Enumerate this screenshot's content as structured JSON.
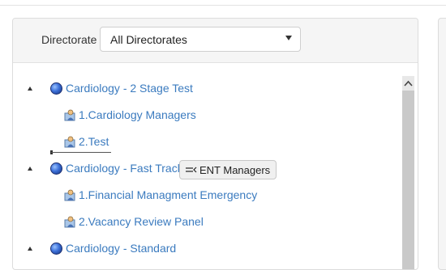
{
  "filter": {
    "label": "Directorate",
    "selected": "All Directorates"
  },
  "tree": {
    "nodes": [
      {
        "label": "Cardiology - 2 Stage Test",
        "icon": "globe-icon",
        "children": [
          {
            "label": "1.Cardiology Managers",
            "icon": "person-icon"
          },
          {
            "label": "2.Test",
            "icon": "person-icon"
          }
        ]
      },
      {
        "label": "Cardiology - Fast Track",
        "icon": "globe-icon",
        "children": [
          {
            "label": "1.Financial Managment Emergency",
            "icon": "person-icon"
          },
          {
            "label": "2.Vacancy Review Panel",
            "icon": "person-icon"
          }
        ]
      },
      {
        "label": "Cardiology - Standard",
        "icon": "globe-icon",
        "children": []
      }
    ]
  },
  "drag_tooltip": {
    "label": "ENT Managers",
    "icon": "drag-insert-icon"
  }
}
